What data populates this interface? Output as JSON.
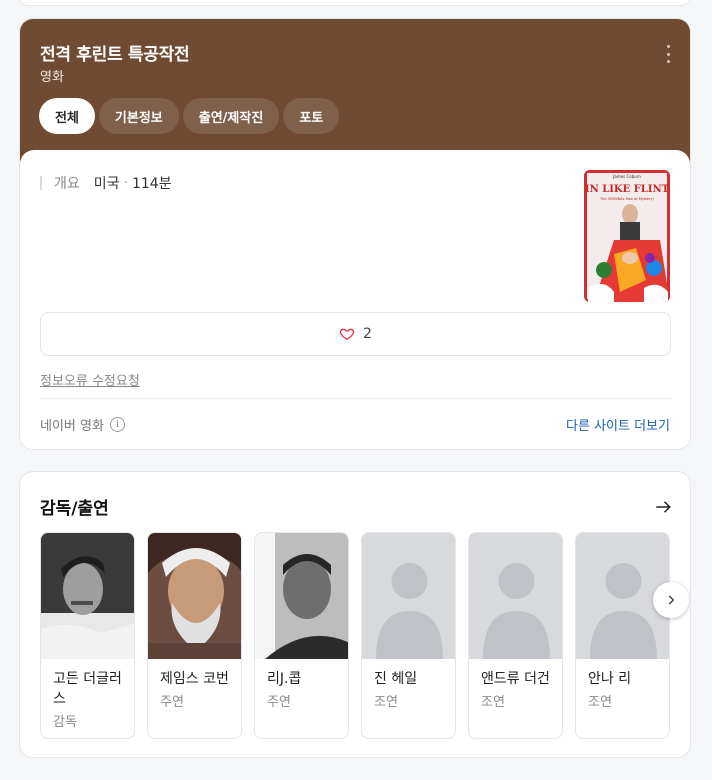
{
  "header": {
    "title": "전격 후린트 특공작전",
    "subtitle": "영화",
    "more_icon": "more-vertical-icon",
    "background": "#6e4b32"
  },
  "tabs": [
    {
      "label": "전체",
      "active": true
    },
    {
      "label": "기본정보",
      "active": false
    },
    {
      "label": "출연/제작진",
      "active": false
    },
    {
      "label": "포토",
      "active": false
    }
  ],
  "overview": {
    "label": "개요",
    "country": "미국",
    "separator": "·",
    "runtime": "114분"
  },
  "poster": {
    "title_art": "IN LIKE FLINT",
    "tagline": "The ORIGINAL Man of Mystery!"
  },
  "like": {
    "icon": "heart-icon",
    "count": "2"
  },
  "report_link": "정보오류 수정요청",
  "source": {
    "label": "네이버 영화",
    "icon": "info-icon"
  },
  "other_sites": "다른 사이트 더보기",
  "cast": {
    "title": "감독/출연",
    "arrow_icon": "arrow-right-icon",
    "people": [
      {
        "name": "고든 더글러스",
        "role": "감독"
      },
      {
        "name": "제임스 코번",
        "role": "주연"
      },
      {
        "name": "리J.콥",
        "role": "주연"
      },
      {
        "name": "진 헤일",
        "role": "조연"
      },
      {
        "name": "앤드류 더건",
        "role": "조연"
      },
      {
        "name": "안나 리",
        "role": "조연"
      }
    ],
    "next_icon": "chevron-right-icon"
  }
}
